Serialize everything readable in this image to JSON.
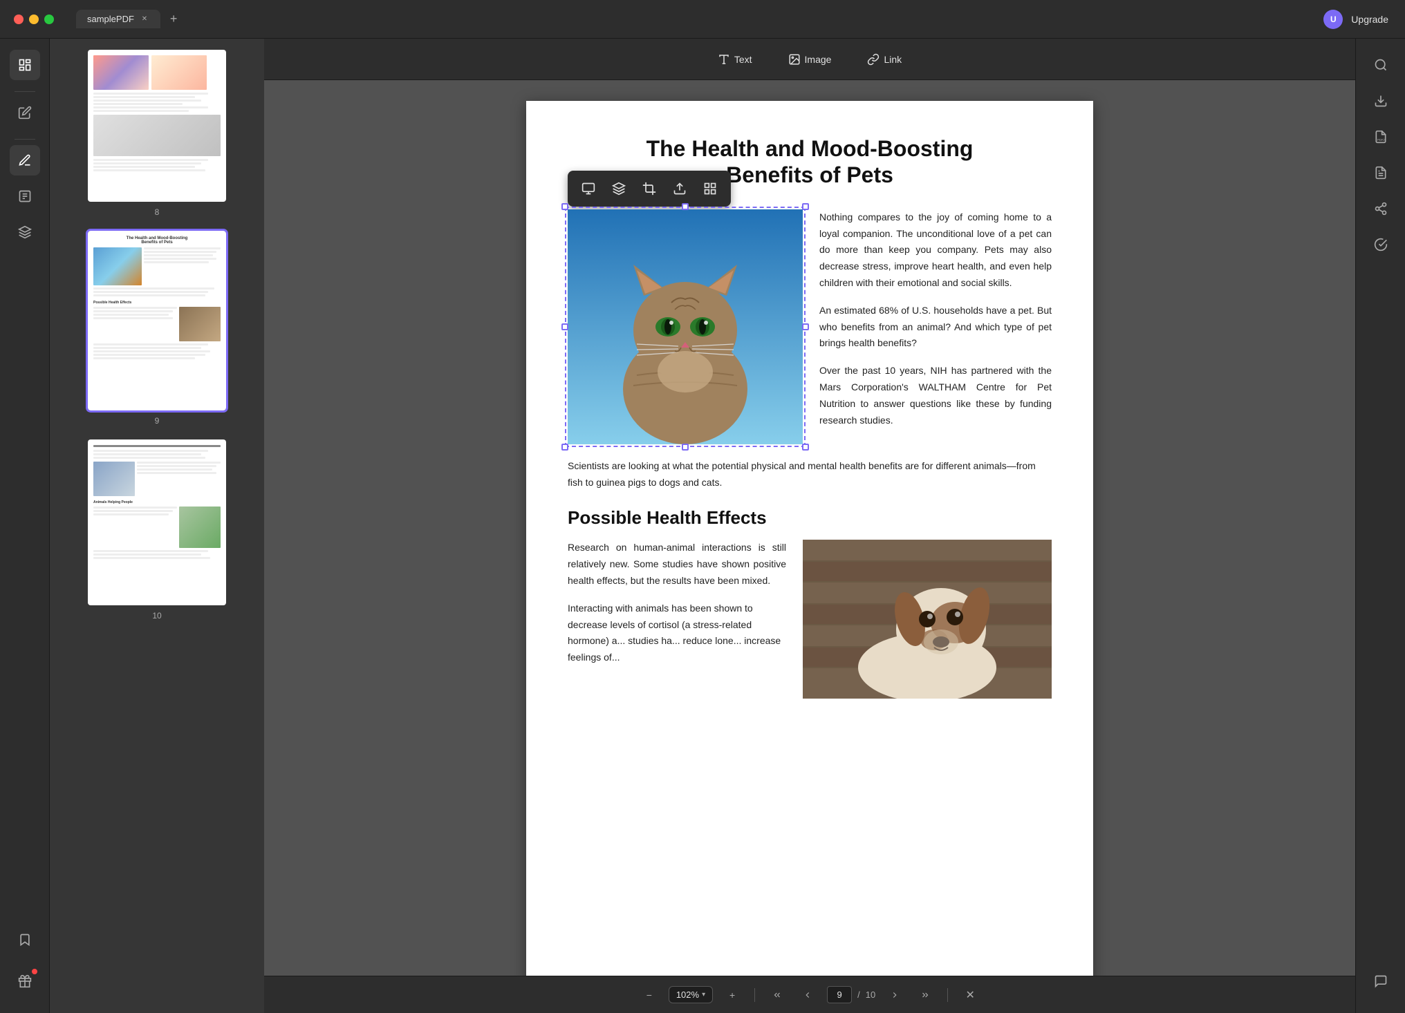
{
  "titlebar": {
    "tab_name": "samplePDF",
    "upgrade_label": "Upgrade",
    "user_initial": "U"
  },
  "toolbar": {
    "text_label": "Text",
    "image_label": "Image",
    "link_label": "Link"
  },
  "pdf": {
    "page_title_line1": "The Health and Mood-Boosting",
    "page_title_line2": "Benefits of Pets",
    "para1": "Nothing compares to the joy of coming home to a loyal companion. The unconditional love of a pet can do more than keep you company. Pets may also decrease stress, improve heart health,  and  even  help children  with  their emotional and social skills.",
    "para2": "An estimated 68% of U.S. households have a pet. But who benefits from an animal? And which type of pet brings health benefits?",
    "para3": "Over  the  past  10  years,  NIH  has partnered with the Mars Corporation's WALTHAM Centre for  Pet  Nutrition  to answer  questions  like these by funding research studies.",
    "full_text": "Scientists are looking at what the potential physical and mental health benefits are for different animals—from fish to guinea pigs to dogs and cats.",
    "section_heading": "Possible Health Effects",
    "para4": "Research  on  human-animal  interactions is  still  relatively  new.  Some  studies  have shown  positive  health  effects,  but  the results have been mixed.",
    "para5": "Interacting with animals has been shown to decrease levels of cortisol (a stress-related hormone) a... studies ha... reduce lone... increase feelings of..."
  },
  "bottom_bar": {
    "zoom_label": "102%",
    "page_current": "9",
    "page_total": "10"
  },
  "thumbnails": [
    {
      "page_num": "8"
    },
    {
      "page_num": "9"
    },
    {
      "page_num": "10"
    }
  ],
  "context_toolbar_icons": [
    "layout-icon",
    "layers-icon",
    "crop-icon",
    "export-icon",
    "grid-icon"
  ],
  "sidebar_left_icons": [
    {
      "name": "panel-icon",
      "active": true
    },
    {
      "name": "edit-icon",
      "active": false
    },
    {
      "name": "annotate-icon",
      "active": true
    },
    {
      "name": "forms-icon",
      "active": false
    },
    {
      "name": "stack-icon",
      "active": false
    },
    {
      "name": "bookmark-icon",
      "active": false
    },
    {
      "name": "gift-icon",
      "active": false,
      "badge": true
    }
  ],
  "sidebar_right_icons": [
    {
      "name": "search-icon"
    },
    {
      "name": "import-icon"
    },
    {
      "name": "pdf-a-icon"
    },
    {
      "name": "doc-icon"
    },
    {
      "name": "share-icon"
    },
    {
      "name": "check-icon"
    },
    {
      "name": "chat-icon"
    }
  ]
}
